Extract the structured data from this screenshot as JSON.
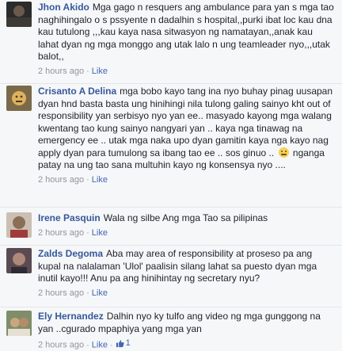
{
  "comments": [
    {
      "author": "Jhon Akido",
      "text": "Mga gago n resquers ang ambulance para yan s mga tao naghihingalo o s pssyente n dadalhin s hospital,,purki ibat loc kau dna kau tutulong ,,,kau kaya nasa sitwasyon ng namatayan,,anak kau lahat dyan ng mga monggo ang utak lalo n ung teamleader nyo,,,utak balot,,",
      "time": "2 hours ago",
      "like_label": "Like"
    },
    {
      "author": "Crisanto A Delina",
      "text": "mga bobo kayo tang ina nyo buhay pinag uusapan dyan hnd basta basta ung hinihingi nila tulong galing sainyo kht out of responsibility yan serbisyo nyo yan ee.. masyado kayong mga walang kwentang tao kung sainyo nangyari yan .. kaya nga tinawag na emergency ee .. utak mga naka upo dyan gamitin kaya nga kayo nag apply dyan para tumulong sa ibang tao ee .. sos ginuo ..",
      "text_after": "nganga patay na ung tao sana multuhin kayo ng konsensya nyo ....",
      "emoji": "sad-face",
      "time": "2 hours ago",
      "like_label": "Like"
    },
    {
      "author": "Irene Pasquin",
      "text": "Wala ng silbe Ang mga Tao sa pilipinas",
      "time": "2 hours ago",
      "like_label": "Like"
    },
    {
      "author": "Zalds Degoma",
      "text": "Aba may area of responsibility at proseso pa ang kupal na nalalaman 'Ulol' paalisin silang lahat sa puesto dyan mga inutil kayo!!! Anu pa ang hinihintay ng secretary nyu?",
      "time": "2 hours ago",
      "like_label": "Like"
    },
    {
      "author": "Ely Hernandez",
      "text": "Dalhin nyo ky tulfo ang video ng mga gunggong na yan ..cgurado mpaphiya yang mga yan",
      "time": "2 hours ago",
      "like_label": "Like",
      "like_count": "1"
    }
  ],
  "colors": {
    "link": "#365899",
    "meta": "#90949c",
    "like": "#4267b2"
  }
}
